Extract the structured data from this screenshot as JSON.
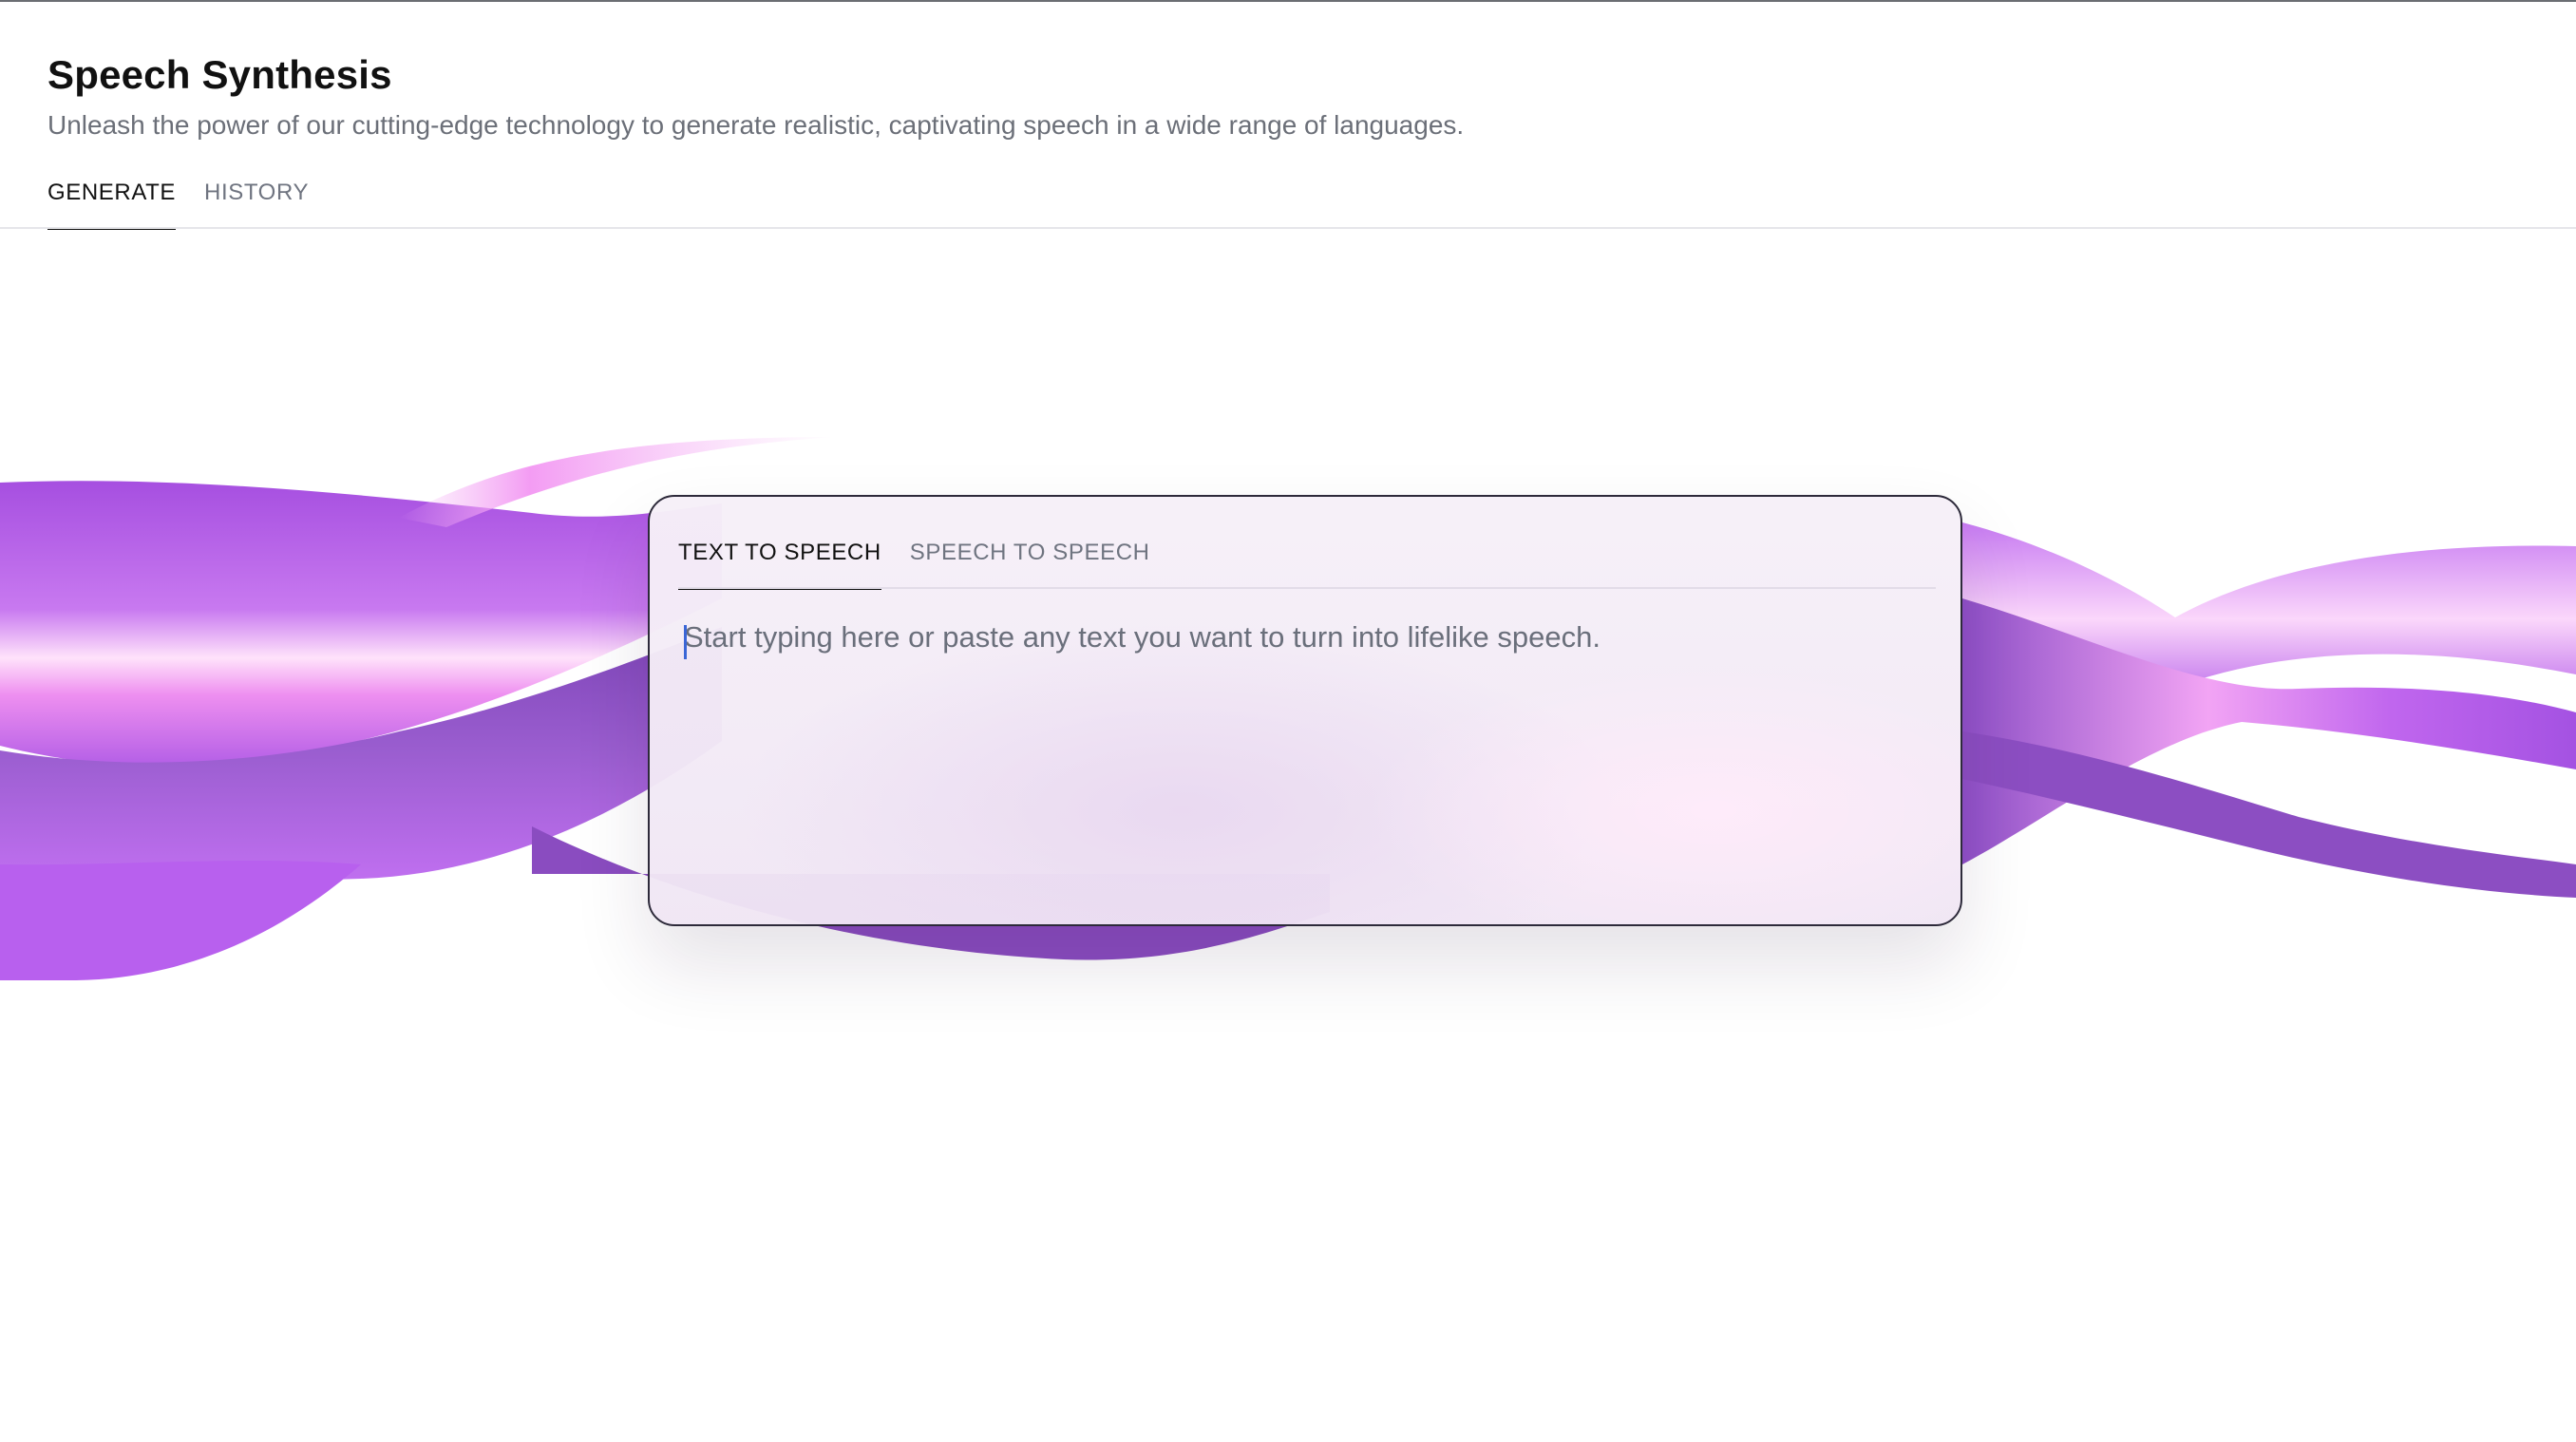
{
  "header": {
    "title": "Speech Synthesis",
    "subtitle": "Unleash the power of our cutting-edge technology to generate realistic, captivating speech in a wide range of languages."
  },
  "main_tabs": [
    {
      "label": "GENERATE",
      "active": true
    },
    {
      "label": "HISTORY",
      "active": false
    }
  ],
  "card": {
    "tabs": [
      {
        "label": "TEXT TO SPEECH",
        "active": true
      },
      {
        "label": "SPEECH TO SPEECH",
        "active": false
      }
    ],
    "input": {
      "value": "",
      "placeholder": "Start typing here or paste any text you want to turn into lifelike speech."
    }
  },
  "colors": {
    "wave_primary": "#b45ae6",
    "wave_highlight": "#f6a8f4",
    "wave_dark": "#8a4cc0",
    "caret": "#3a66d6"
  }
}
